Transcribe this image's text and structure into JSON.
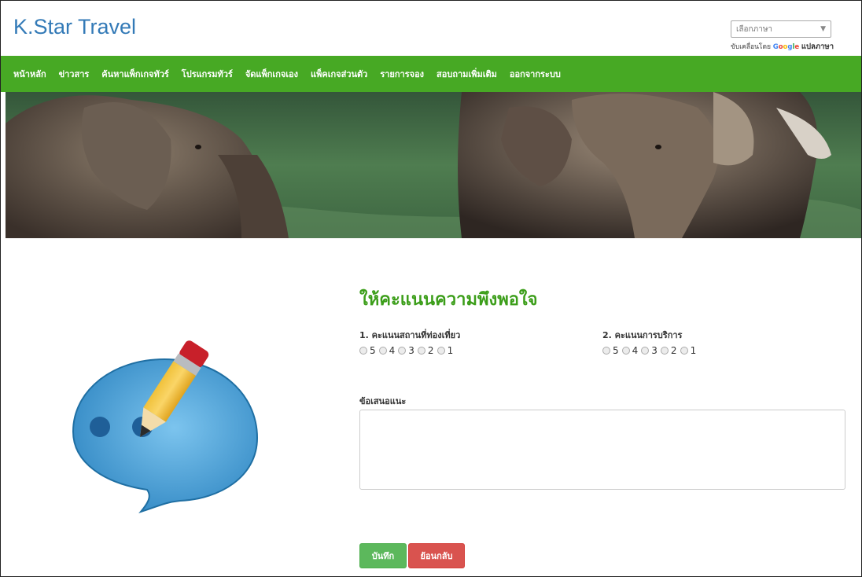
{
  "header": {
    "brand": "K.Star Travel",
    "language_select": {
      "value": "เลือกภาษา"
    },
    "powered_by": {
      "prefix": "ขับเคลื่อนโดย",
      "google": [
        "G",
        "o",
        "o",
        "g",
        "l",
        "e"
      ],
      "translate": "แปลภาษา"
    }
  },
  "nav": {
    "items": [
      "หน้าหลัก",
      "ข่าวสาร",
      "ค้นหาแพ็กเกจทัวร์",
      "โปรแกรมทัวร์",
      "จัดแพ็กเกจเอง",
      "แพ็คเกจส่วนตัว",
      "รายการจอง",
      "สอบถามเพิ่มเติม",
      "ออกจากระบบ"
    ]
  },
  "form": {
    "title": "ให้คะแนนความพึงพอใจ",
    "q1": {
      "label": "1. คะแนนสถานที่ท่องเที่ยว",
      "options": [
        "5",
        "4",
        "3",
        "2",
        "1"
      ]
    },
    "q2": {
      "label": "2. คะแนนการบริการ",
      "options": [
        "5",
        "4",
        "3",
        "2",
        "1"
      ]
    },
    "suggestion_label": "ข้อเสนอแนะ",
    "suggestion_value": "",
    "save_label": "บันทึก",
    "back_label": "ย้อนกลับ"
  },
  "colors": {
    "nav_bg": "#47a924",
    "title": "#3c9e1a",
    "brand": "#337ab7",
    "save": "#5cb85c",
    "back": "#d9534f"
  },
  "icons": [
    "chevron-down-icon",
    "chat-bubble-icon",
    "pencil-icon",
    "resize-handle-icon"
  ]
}
